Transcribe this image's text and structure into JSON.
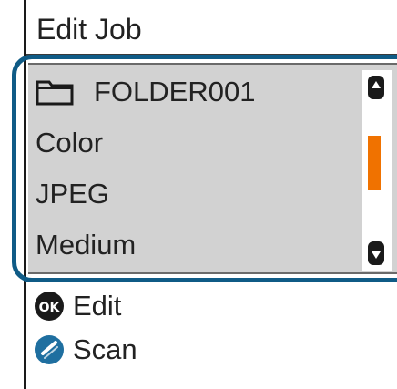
{
  "title": "Edit Job",
  "job_list": {
    "folder_name": "FOLDER001",
    "items": [
      "Color",
      "JPEG",
      "Medium"
    ],
    "scroll_position": 0.35
  },
  "softkeys": {
    "edit": {
      "key": "OK",
      "label": "Edit"
    },
    "scan": {
      "label": "Scan"
    }
  },
  "colors": {
    "accent_frame": "#0f5b86",
    "scroll_thumb": "#f07200",
    "panel": "#d2d2d2"
  },
  "icons": [
    "folder-icon",
    "scroll-up-icon",
    "scroll-down-icon",
    "ok-button-icon",
    "scan-button-icon"
  ]
}
